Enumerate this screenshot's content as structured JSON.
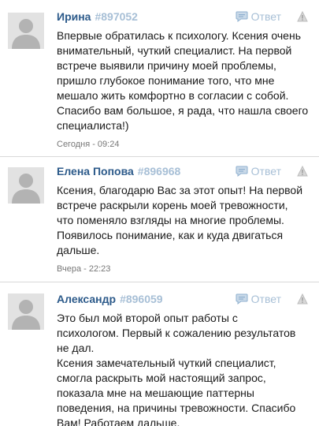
{
  "reply_label": "Ответ",
  "reviews": [
    {
      "author": "Ирина",
      "post_id": "#897052",
      "text": "Впервые обратилась к психологу. Ксения очень\nвнимательный, чуткий специалист. На первой\nвстрече выявили причину моей проблемы,\nпришло глубокое понимание того, что мне\nмешало жить комфортно в согласии с собой.\nСпасибо вам большое, я рада, что нашла своего\nспециалиста!)",
      "time": "Сегодня - 09:24"
    },
    {
      "author": "Елена Попова",
      "post_id": "#896968",
      "text": "Ксения, благодарю Вас за этот опыт! На первой\nвстрече раскрыли корень моей тревожности,\nчто поменяло взгляды на многие проблемы.\nПоявилось понимание, как и куда двигаться\nдальше.",
      "time": "Вчера - 22:23"
    },
    {
      "author": "Александр",
      "post_id": "#896059",
      "text": "Это был мой второй опыт работы с\nпсихологом. Первый к сожалению результатов\nне дал.\nКсения замечательный чуткий специалист,\nсмогла раскрыть мой настоящий запрос,\nпоказала мне на мешающие паттерны\nповедения, на причины тревожности. Спасибо\nВам! Работаем дальше.",
      "time": ""
    }
  ],
  "colors": {
    "author": "#2c5a8a",
    "link_muted": "#a7bfd6",
    "text": "#1a1a1a",
    "time": "#777777",
    "avatar_bg": "#e2e2e2",
    "avatar_fg": "#b3b3b3",
    "separator": "#d9d9d9"
  }
}
